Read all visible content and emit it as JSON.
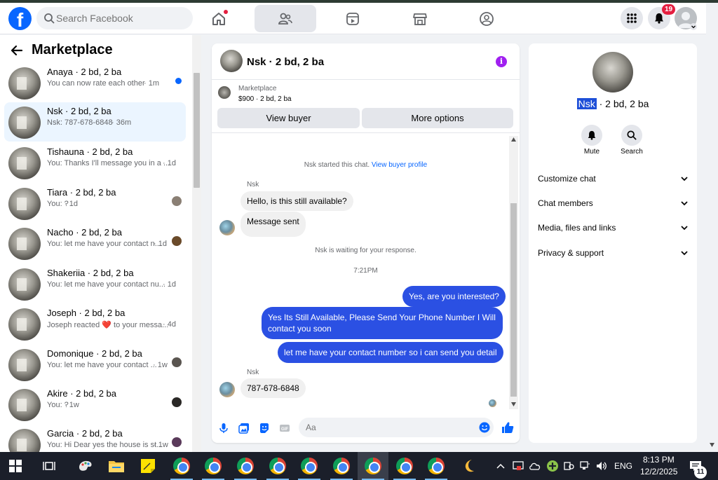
{
  "header": {
    "search_placeholder": "Search Facebook",
    "notifications_badge": "19",
    "nav": [
      "home",
      "friends",
      "watch",
      "marketplace",
      "groups"
    ]
  },
  "left": {
    "title": "Marketplace",
    "conversations": [
      {
        "name": "Anaya · 2 bd, 2 ba",
        "snippet": "You can now rate each other",
        "time": "· 1m",
        "unread": true
      },
      {
        "name": "Nsk · 2 bd, 2 ba",
        "snippet": "Nsk: 787-678-6848",
        "time": "· 36m",
        "selected": true
      },
      {
        "name": "Tishauna · 2 bd, 2 ba",
        "snippet": "You: Thanks I'll message you in a ...",
        "time": "· 1d"
      },
      {
        "name": "Tiara · 2 bd, 2 ba",
        "snippet": "You: ?",
        "time": "· 1d"
      },
      {
        "name": "Nacho · 2 bd, 2 ba",
        "snippet": "You: let me have your contact n...",
        "time": "· 1d"
      },
      {
        "name": "Shakeriia · 2 bd, 2 ba",
        "snippet": "You: let me have your contact nu...",
        "time": "· 1d"
      },
      {
        "name": "Joseph · 2 bd, 2 ba",
        "snippet": "Joseph reacted ❤️ to your messa...",
        "time": "· 4d"
      },
      {
        "name": "Domonique · 2 bd, 2 ba",
        "snippet": "You: let me have your contact ...",
        "time": "· 1w"
      },
      {
        "name": "Akire · 2 bd, 2 ba",
        "snippet": "You: ?",
        "time": "· 1w"
      },
      {
        "name": "Garcia · 2 bd, 2 ba",
        "snippet": "You: Hi Dear yes the house is st...",
        "time": "· 1w"
      }
    ]
  },
  "chat": {
    "title": "Nsk · 2 bd, 2 ba",
    "listing_source": "Marketplace",
    "listing_price": "$900 · 2 bd, 2 ba",
    "view_buyer": "View buyer",
    "more_options": "More options",
    "started_text": "Nsk started this chat.",
    "view_buyer_profile": "View buyer profile",
    "sender": "Nsk",
    "msg1": "Hello, is this still available?",
    "msg2": "Message sent",
    "waiting": "Nsk is waiting for your response.",
    "timestamp": "7:21PM",
    "out1": "Yes, are you interested?",
    "out2": "Yes Its Still Available, Please Send Your Phone Number I Will contact you soon",
    "out3": "let me have your contact number so i can send you detail",
    "sender2": "Nsk",
    "msg3": "787-678-6848",
    "composer_placeholder": "Aa"
  },
  "right": {
    "title_highlight": "Nsk",
    "title_rest": " · 2 bd, 2 ba",
    "mute": "Mute",
    "search": "Search",
    "sections": [
      "Customize chat",
      "Chat members",
      "Media, files and links",
      "Privacy & support"
    ]
  },
  "taskbar": {
    "language": "ENG",
    "time": "8:13 PM",
    "date": "12/2/2025",
    "notif_count": "11"
  },
  "colors": {
    "brand": "#0866ff",
    "outgoing_bubble": "#2b50e3",
    "badge": "#e41e3f",
    "info": "#a020f0"
  }
}
